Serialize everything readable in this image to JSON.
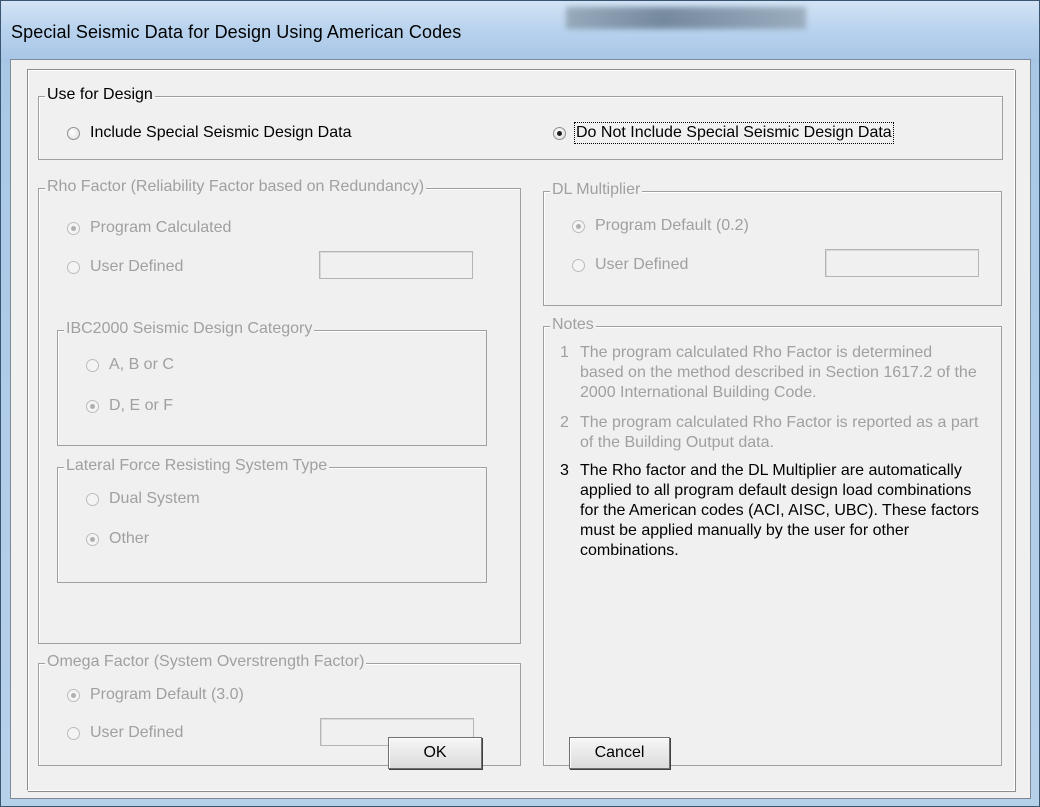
{
  "window": {
    "title": "Special Seismic Data for Design Using American Codes"
  },
  "use_for_design": {
    "legend": "Use for Design",
    "include_label": "Include Special Seismic Design Data",
    "exclude_label": "Do Not Include Special Seismic Design Data",
    "selected": "exclude"
  },
  "rho": {
    "legend": "Rho Factor (Reliability Factor based on Redundancy)",
    "program_calculated": "Program Calculated",
    "user_defined": "User Defined",
    "user_value": "",
    "selected": "program_calculated"
  },
  "ibc": {
    "legend": "IBC2000 Seismic Design Category",
    "abc": "A, B or C",
    "def": "D, E or F",
    "selected": "def"
  },
  "lateral": {
    "legend": "Lateral Force Resisting System Type",
    "dual": "Dual System",
    "other": "Other",
    "selected": "other"
  },
  "omega": {
    "legend": "Omega Factor (System Overstrength Factor)",
    "program_default": "Program Default (3.0)",
    "user_defined": "User Defined",
    "user_value": "",
    "selected": "program_default"
  },
  "dl": {
    "legend": "DL Multiplier",
    "program_default": "Program Default (0.2)",
    "user_defined": "User Defined",
    "user_value": "",
    "selected": "program_default"
  },
  "notes": {
    "legend": "Notes",
    "items": [
      {
        "num": "1",
        "text": "The program calculated Rho Factor is determined based on the method described in Section 1617.2 of the 2000 International Building Code.",
        "enabled": false
      },
      {
        "num": "2",
        "text": "The program calculated Rho Factor is reported as a part of the Building Output data.",
        "enabled": false
      },
      {
        "num": "3",
        "text": "The Rho factor and the DL Multiplier are automatically applied to all program default design load combinations for the American codes (ACI, AISC, UBC).  These factors must be applied manually by the user for other combinations.",
        "enabled": true
      }
    ]
  },
  "buttons": {
    "ok": "OK",
    "cancel": "Cancel"
  }
}
